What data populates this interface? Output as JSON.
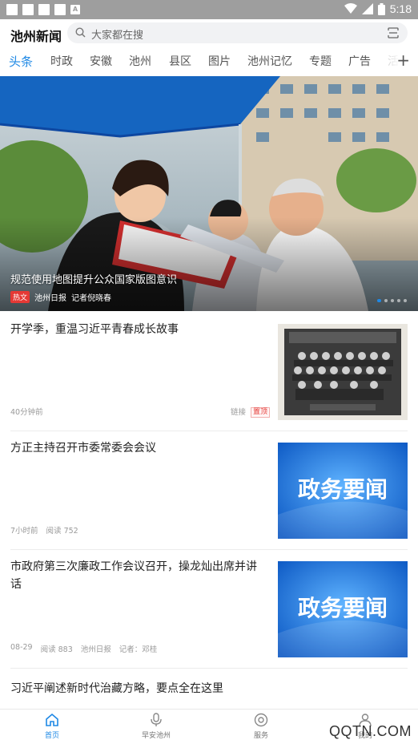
{
  "status_bar": {
    "time": "5:18"
  },
  "header": {
    "title": "池州新闻",
    "search_placeholder": "大家都在搜"
  },
  "tabs": [
    "头条",
    "时政",
    "安徽",
    "池州",
    "县区",
    "图片",
    "池州记忆",
    "专题",
    "广告",
    "活"
  ],
  "active_tab": "头条",
  "hero": {
    "caption": "规范使用地图提升公众国家版图意识",
    "tag": "热文",
    "source": "池州日报",
    "author": "记者倪晓春"
  },
  "news": [
    {
      "title": "开学季，重温习近平青春成长故事",
      "time": "40分钟前",
      "link": "链接",
      "badge": "置顶",
      "thumb": "group-photo"
    },
    {
      "title": "方正主持召开市委常委会会议",
      "time": "7小时前",
      "reads": "阅读 752",
      "thumb_text": "政务要闻"
    },
    {
      "title": "市政府第三次廉政工作会议召开，操龙灿出席并讲话",
      "time": "08-29",
      "reads": "阅读 883",
      "source": "池州日报",
      "author": "记者：邓桂",
      "thumb_text": "政务要闻"
    },
    {
      "title": "习近平阐述新时代治藏方略，要点全在这里"
    }
  ],
  "bottom_nav": [
    {
      "label": "首页",
      "icon": "home-icon",
      "active": true
    },
    {
      "label": "早安池州",
      "icon": "microphone-icon"
    },
    {
      "label": "服务",
      "icon": "service-icon"
    },
    {
      "label": "我的",
      "icon": "user-icon"
    }
  ],
  "watermark": "QQTN.COM",
  "colors": {
    "accent": "#1e88e5",
    "status_bar": "#9e9e9e",
    "badge_red": "#e53935"
  }
}
